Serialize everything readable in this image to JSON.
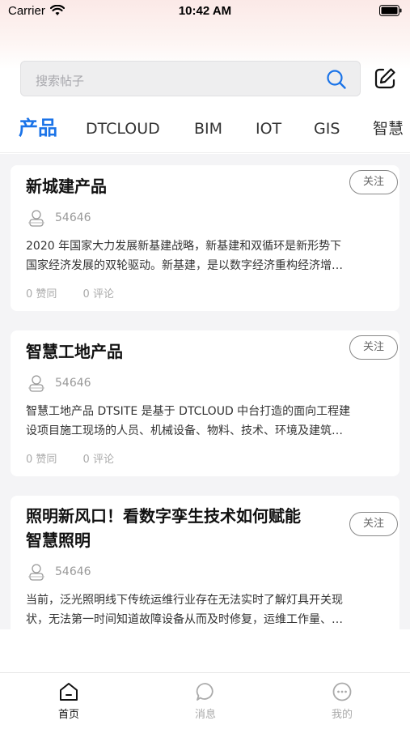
{
  "status_bar": {
    "carrier": "Carrier",
    "time": "10:42 AM"
  },
  "search": {
    "placeholder": "搜索帖子",
    "icon": "search-icon"
  },
  "header": {
    "edit_icon": "edit-icon"
  },
  "tabs": [
    {
      "label": "产品",
      "active": true
    },
    {
      "label": "DTCLOUD",
      "active": false
    },
    {
      "label": "BIM",
      "active": false
    },
    {
      "label": "IOT",
      "active": false
    },
    {
      "label": "GIS",
      "active": false
    },
    {
      "label": "智慧",
      "active": false
    }
  ],
  "posts": [
    {
      "title_lines": [
        "新城建产品"
      ],
      "follow_label": "关注",
      "author_id": "54646",
      "excerpt_lines": [
        "2020 年国家大力发展新基建战略，新基建和双循环是新形势下",
        "国家经济发展的双轮驱动。新基建，是以数字经济重构经济增…"
      ],
      "likes": "0 赞同",
      "comments": "0 评论"
    },
    {
      "title_lines": [
        "智慧工地产品"
      ],
      "follow_label": "关注",
      "author_id": "54646",
      "excerpt_lines": [
        "智慧工地产品 DTSITE 是基于 DTCLOUD 中台打造的面向工程建",
        "设项目施工现场的人员、机械设备、物料、技术、环境及建筑…"
      ],
      "likes": "0 赞同",
      "comments": "0 评论"
    },
    {
      "title_lines": [
        "照明新风口！看数字孪生技术如何赋能",
        "智慧照明"
      ],
      "follow_label": "关注",
      "author_id": "54646",
      "excerpt_lines": [
        "当前，泛光照明线下传统运维行业存在无法实时了解灯具开关现",
        "状，无法第一时间知道故障设备从而及时修复，运维工作量、…"
      ]
    }
  ],
  "bottom_nav": [
    {
      "label": "首页",
      "icon": "home-icon",
      "active": true
    },
    {
      "label": "消息",
      "icon": "message-icon",
      "active": false
    },
    {
      "label": "我的",
      "icon": "profile-icon",
      "active": false
    }
  ],
  "colors": {
    "accent": "#1a73e8",
    "header_tint": "#fbe9e7",
    "feed_background": "#f4f4f6"
  }
}
